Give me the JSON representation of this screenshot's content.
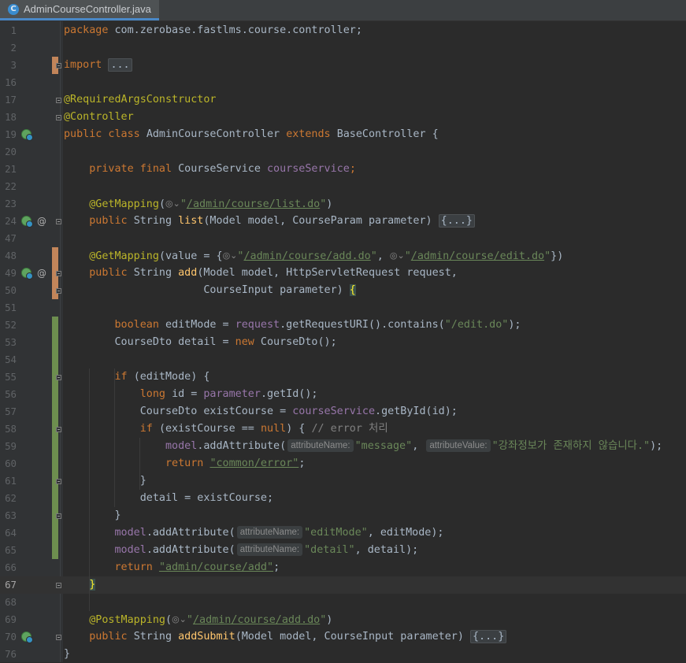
{
  "tab": {
    "icon_letter": "C",
    "label": "AdminCourseController.java"
  },
  "gutter_icons": {
    "bean_icon": "spring-bean-icon",
    "at_icon": "@",
    "fold_icon": "fold-marker-icon"
  },
  "lines": [
    {
      "n": "1",
      "segs": [
        [
          "kw",
          "package "
        ],
        [
          "",
          "com.zerobase.fastlms.course.controller;"
        ]
      ]
    },
    {
      "n": "2",
      "segs": []
    },
    {
      "n": "3",
      "segs": [
        [
          "kw",
          "import "
        ],
        [
          "fold",
          "..."
        ]
      ]
    },
    {
      "n": "16",
      "segs": []
    },
    {
      "n": "17",
      "segs": [
        [
          "ann",
          "@RequiredArgsConstructor"
        ]
      ]
    },
    {
      "n": "18",
      "segs": [
        [
          "ann",
          "@Controller"
        ]
      ]
    },
    {
      "n": "19",
      "segs": [
        [
          "kw",
          "public class "
        ],
        [
          "",
          "AdminCourseController "
        ],
        [
          "kw",
          "extends "
        ],
        [
          "",
          "BaseController {"
        ]
      ]
    },
    {
      "n": "20",
      "segs": []
    },
    {
      "n": "21",
      "segs": [
        [
          "",
          "    "
        ],
        [
          "kw",
          "private final "
        ],
        [
          "",
          "CourseService "
        ],
        [
          "fld",
          "courseService"
        ],
        [
          "kw",
          ";"
        ]
      ]
    },
    {
      "n": "22",
      "segs": []
    },
    {
      "n": "23",
      "segs": [
        [
          "",
          "    "
        ],
        [
          "ann",
          "@GetMapping"
        ],
        [
          "",
          "("
        ],
        [
          "globe",
          "◎⌄"
        ],
        [
          "str",
          "\""
        ],
        [
          "strurl",
          "/admin/course/list.do"
        ],
        [
          "str",
          "\""
        ],
        [
          "",
          ")"
        ]
      ]
    },
    {
      "n": "24",
      "segs": [
        [
          "",
          "    "
        ],
        [
          "kw",
          "public "
        ],
        [
          "",
          "String "
        ],
        [
          "mth",
          "list"
        ],
        [
          "",
          "(Model model, CourseParam parameter) "
        ],
        [
          "fold",
          "{...}"
        ]
      ]
    },
    {
      "n": "47",
      "segs": []
    },
    {
      "n": "48",
      "segs": [
        [
          "",
          "    "
        ],
        [
          "ann",
          "@GetMapping"
        ],
        [
          "",
          "(value = {"
        ],
        [
          "globe",
          "◎⌄"
        ],
        [
          "str",
          "\""
        ],
        [
          "strurl",
          "/admin/course/add.do"
        ],
        [
          "str",
          "\""
        ],
        [
          "",
          ", "
        ],
        [
          "globe",
          "◎⌄"
        ],
        [
          "str",
          "\""
        ],
        [
          "strurl",
          "/admin/course/edit.do"
        ],
        [
          "str",
          "\""
        ],
        [
          "",
          "})"
        ]
      ]
    },
    {
      "n": "49",
      "segs": [
        [
          "",
          "    "
        ],
        [
          "kw",
          "public "
        ],
        [
          "",
          "String "
        ],
        [
          "mth",
          "add"
        ],
        [
          "",
          "(Model model, HttpServletRequest request,"
        ]
      ]
    },
    {
      "n": "50",
      "segs": [
        [
          "",
          "                      CourseInput parameter) "
        ],
        [
          "bracehl",
          "{"
        ]
      ]
    },
    {
      "n": "51",
      "segs": []
    },
    {
      "n": "52",
      "segs": [
        [
          "",
          "        "
        ],
        [
          "kw",
          "boolean "
        ],
        [
          "",
          "editMode = "
        ],
        [
          "fld",
          "request"
        ],
        [
          "",
          ".getRequestURI().contains("
        ],
        [
          "str",
          "\"/edit.do\""
        ],
        [
          "",
          ");"
        ]
      ]
    },
    {
      "n": "53",
      "segs": [
        [
          "",
          "        CourseDto detail = "
        ],
        [
          "kw",
          "new "
        ],
        [
          "",
          "CourseDto();"
        ]
      ]
    },
    {
      "n": "54",
      "segs": []
    },
    {
      "n": "55",
      "segs": [
        [
          "",
          "        "
        ],
        [
          "kw",
          "if "
        ],
        [
          "",
          "(editMode) {"
        ]
      ]
    },
    {
      "n": "56",
      "segs": [
        [
          "",
          "            "
        ],
        [
          "kw",
          "long "
        ],
        [
          "",
          "id = "
        ],
        [
          "fld",
          "parameter"
        ],
        [
          "",
          ".getId();"
        ]
      ]
    },
    {
      "n": "57",
      "segs": [
        [
          "",
          "            CourseDto existCourse = "
        ],
        [
          "fld",
          "courseService"
        ],
        [
          "",
          ".getById(id);"
        ]
      ]
    },
    {
      "n": "58",
      "segs": [
        [
          "",
          "            "
        ],
        [
          "kw",
          "if "
        ],
        [
          "",
          "(existCourse == "
        ],
        [
          "kw",
          "null"
        ],
        [
          "",
          ") { "
        ],
        [
          "cmt",
          "// error 처리"
        ]
      ]
    },
    {
      "n": "59",
      "segs": [
        [
          "",
          "                "
        ],
        [
          "fld",
          "model"
        ],
        [
          "",
          ".addAttribute("
        ],
        [
          "hint",
          "attributeName:"
        ],
        [
          "str",
          "\"message\""
        ],
        [
          "",
          ", "
        ],
        [
          "hint",
          "attributeValue:"
        ],
        [
          "str",
          "\"강좌정보가 존재하지 않습니다.\""
        ],
        [
          "",
          ");"
        ]
      ]
    },
    {
      "n": "60",
      "segs": [
        [
          "",
          "                "
        ],
        [
          "kw",
          "return "
        ],
        [
          "strurl",
          "\"common/error\""
        ],
        [
          "",
          ";"
        ]
      ]
    },
    {
      "n": "61",
      "segs": [
        [
          "",
          "            }"
        ]
      ]
    },
    {
      "n": "62",
      "segs": [
        [
          "",
          "            detail = existCourse;"
        ]
      ]
    },
    {
      "n": "63",
      "segs": [
        [
          "",
          "        }"
        ]
      ]
    },
    {
      "n": "64",
      "segs": [
        [
          "",
          "        "
        ],
        [
          "fld",
          "model"
        ],
        [
          "",
          ".addAttribute("
        ],
        [
          "hint",
          "attributeName:"
        ],
        [
          "str",
          "\"editMode\""
        ],
        [
          "",
          ", editMode);"
        ]
      ]
    },
    {
      "n": "65",
      "segs": [
        [
          "",
          "        "
        ],
        [
          "fld",
          "model"
        ],
        [
          "",
          ".addAttribute("
        ],
        [
          "hint",
          "attributeName:"
        ],
        [
          "str",
          "\"detail\""
        ],
        [
          "",
          ", detail);"
        ]
      ]
    },
    {
      "n": "66",
      "segs": [
        [
          "",
          "        "
        ],
        [
          "kw",
          "return "
        ],
        [
          "strurl",
          "\"admin/course/add\""
        ],
        [
          "",
          ";"
        ]
      ]
    },
    {
      "n": "67",
      "segs": [
        [
          "",
          "    "
        ],
        [
          "bracehl",
          "}"
        ]
      ]
    },
    {
      "n": "68",
      "segs": []
    },
    {
      "n": "69",
      "segs": [
        [
          "",
          "    "
        ],
        [
          "ann",
          "@PostMapping"
        ],
        [
          "",
          "("
        ],
        [
          "globe",
          "◎⌄"
        ],
        [
          "str",
          "\""
        ],
        [
          "strurl",
          "/admin/course/add.do"
        ],
        [
          "str",
          "\""
        ],
        [
          "",
          ")"
        ]
      ]
    },
    {
      "n": "70",
      "segs": [
        [
          "",
          "    "
        ],
        [
          "kw",
          "public "
        ],
        [
          "",
          "String "
        ],
        [
          "mth",
          "addSubmit"
        ],
        [
          "",
          "(Model model, CourseInput parameter) "
        ],
        [
          "fold",
          "{...}"
        ]
      ]
    },
    {
      "n": "76",
      "segs": [
        [
          "",
          "}"
        ]
      ]
    }
  ],
  "current_line": "67",
  "bean_lines": [
    "19",
    "24",
    "49",
    "70"
  ],
  "at_lines": [
    "24",
    "49"
  ],
  "fold_lines": [
    "3",
    "17",
    "18",
    "24",
    "49",
    "50",
    "55",
    "58",
    "61",
    "63",
    "67",
    "70"
  ],
  "modified_lines": [
    "3",
    "48",
    "49",
    "50"
  ],
  "added_lines": [
    "52",
    "53",
    "54",
    "55",
    "56",
    "57",
    "58",
    "59",
    "60",
    "61",
    "62",
    "63",
    "64",
    "65"
  ]
}
